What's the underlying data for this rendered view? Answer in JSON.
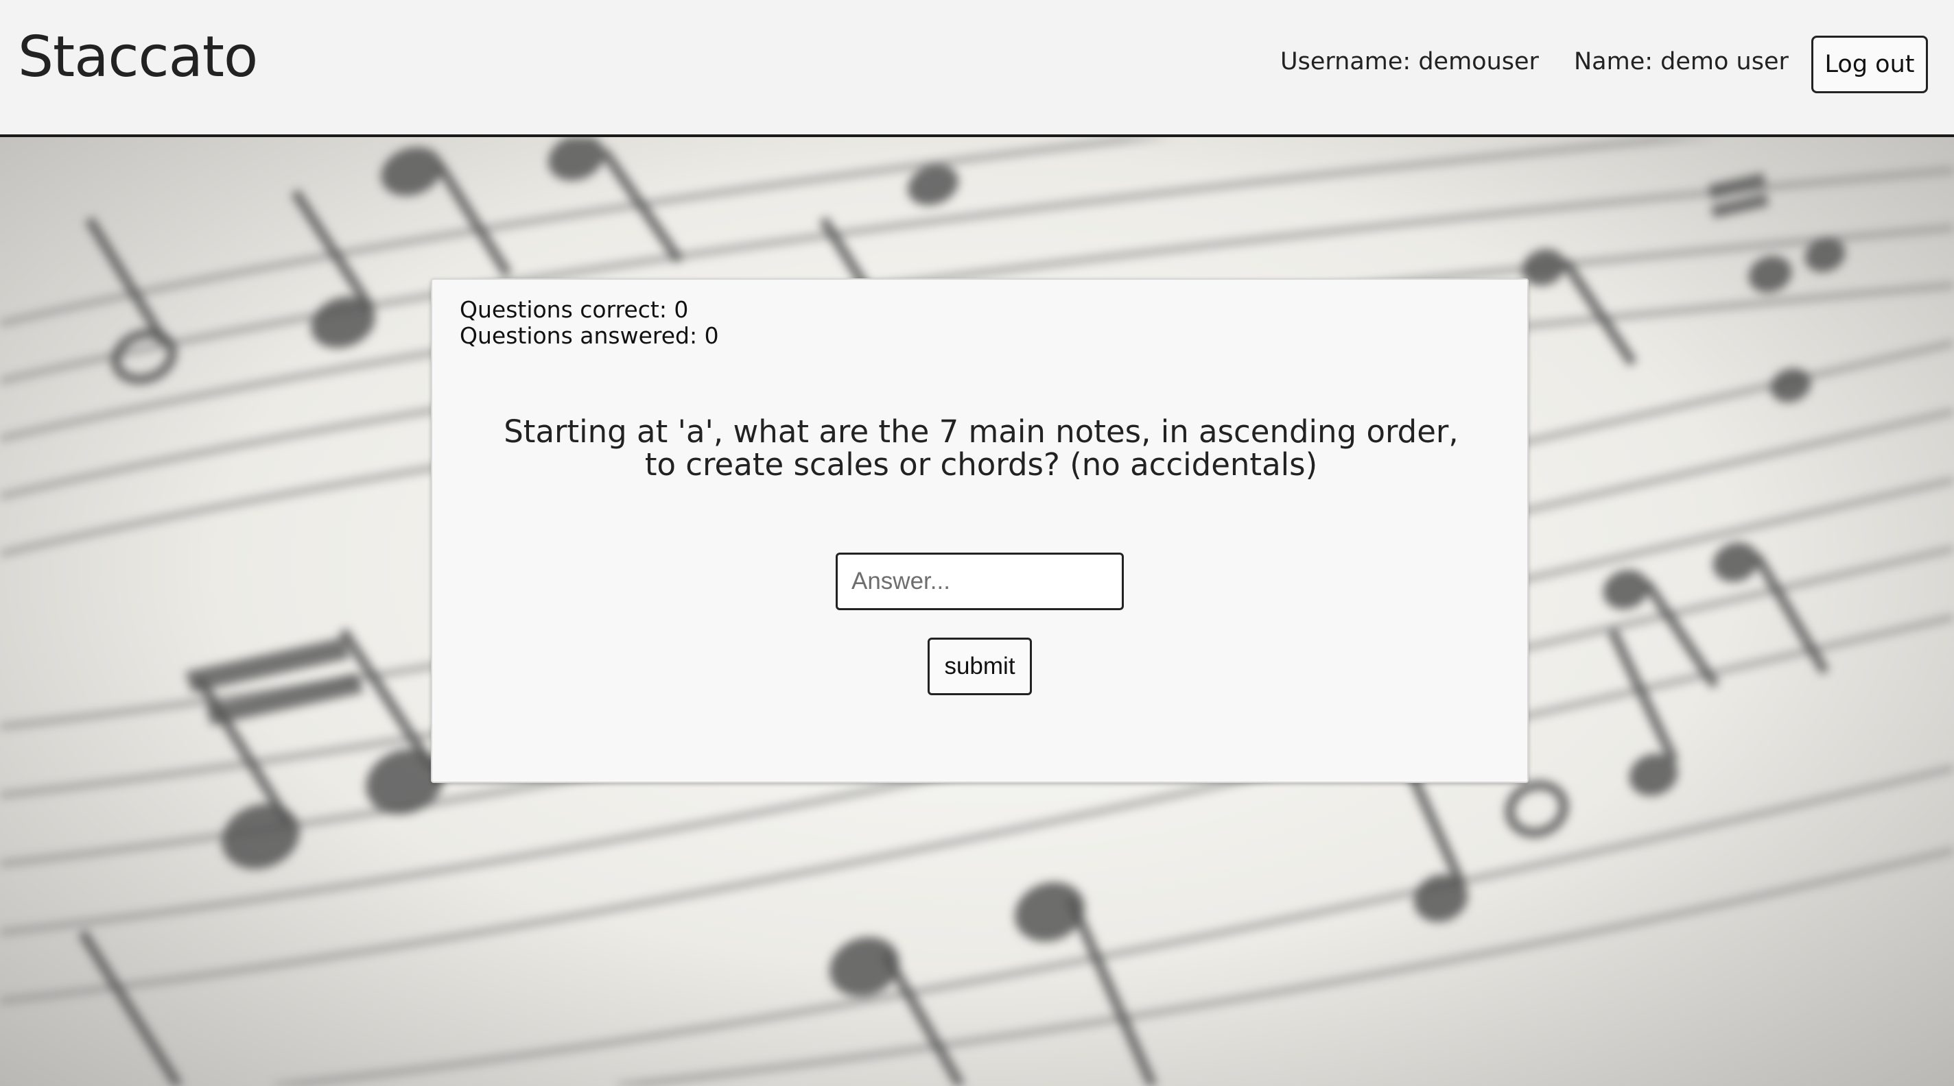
{
  "app": {
    "title": "Staccato"
  },
  "header": {
    "username_text": "Username: demouser",
    "name_text": "Name: demo user",
    "logout_label": "Log out"
  },
  "quiz": {
    "questions_correct": "Questions correct: 0",
    "questions_answered": "Questions answered: 0",
    "question_line1": "Starting at 'a', what are the 7 main notes, in ascending order,",
    "question_line2": "to create scales or chords? (no accidentals)",
    "answer_placeholder": "Answer...",
    "answer_value": "",
    "submit_label": "submit"
  },
  "background": {
    "image": "blurred-sheet-music",
    "ink_color": "#555555"
  }
}
